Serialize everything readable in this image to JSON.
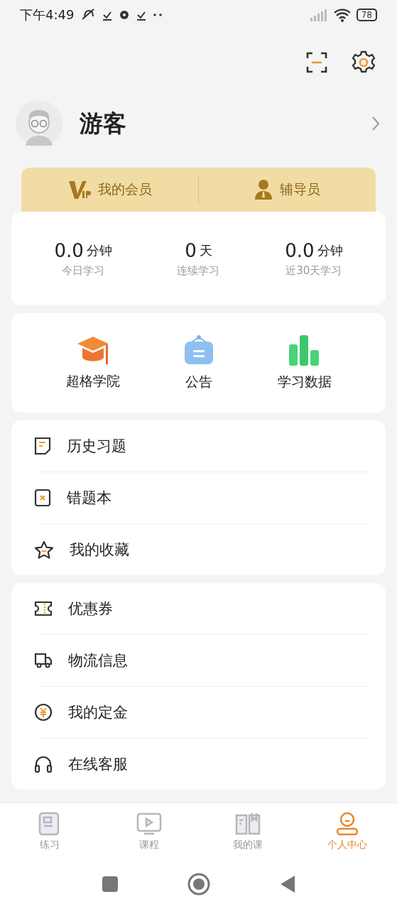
{
  "status_bar": {
    "time": "下午4:49",
    "battery": "78"
  },
  "profile": {
    "name": "游客"
  },
  "membership": [
    {
      "kind": "vip",
      "label": "我的会员"
    },
    {
      "kind": "tutor",
      "label": "辅导员"
    }
  ],
  "stats": [
    {
      "value": "0.0",
      "unit": "分钟",
      "label": "今日学习"
    },
    {
      "value": "0",
      "unit": "天",
      "label": "连续学习"
    },
    {
      "value": "0.0",
      "unit": "分钟",
      "label": "近30天学习"
    }
  ],
  "shortcuts": [
    {
      "kind": "academy",
      "label": "超格学院"
    },
    {
      "kind": "notice",
      "label": "公告"
    },
    {
      "kind": "data",
      "label": "学习数据"
    }
  ],
  "menu_groups": [
    [
      {
        "kind": "history",
        "label": "历史习题"
      },
      {
        "kind": "mistakes",
        "label": "错题本"
      },
      {
        "kind": "favorites",
        "label": "我的收藏"
      }
    ],
    [
      {
        "kind": "coupon",
        "label": "优惠券"
      },
      {
        "kind": "logistics",
        "label": "物流信息"
      },
      {
        "kind": "deposit",
        "label": "我的定金"
      },
      {
        "kind": "service",
        "label": "在线客服"
      }
    ]
  ],
  "tabs": [
    {
      "kind": "practice",
      "label": "练习",
      "selected": false
    },
    {
      "kind": "courses",
      "label": "课程",
      "selected": false
    },
    {
      "kind": "mycourses",
      "label": "我的课",
      "selected": false
    },
    {
      "kind": "profile",
      "label": "个人中心",
      "selected": true
    }
  ]
}
